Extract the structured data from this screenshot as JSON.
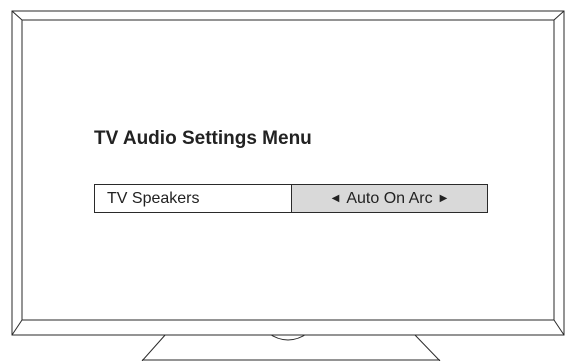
{
  "menu": {
    "title": "TV Audio Settings Menu",
    "setting": {
      "label": "TV Speakers",
      "value": "Auto On Arc",
      "left_arrow_icon": "left-triangle-icon",
      "right_arrow_icon": "right-triangle-icon"
    }
  },
  "colors": {
    "text": "#222222",
    "outline": "#2a2a2a",
    "value_background": "#d9d9d9",
    "screen_background": "#ffffff"
  }
}
